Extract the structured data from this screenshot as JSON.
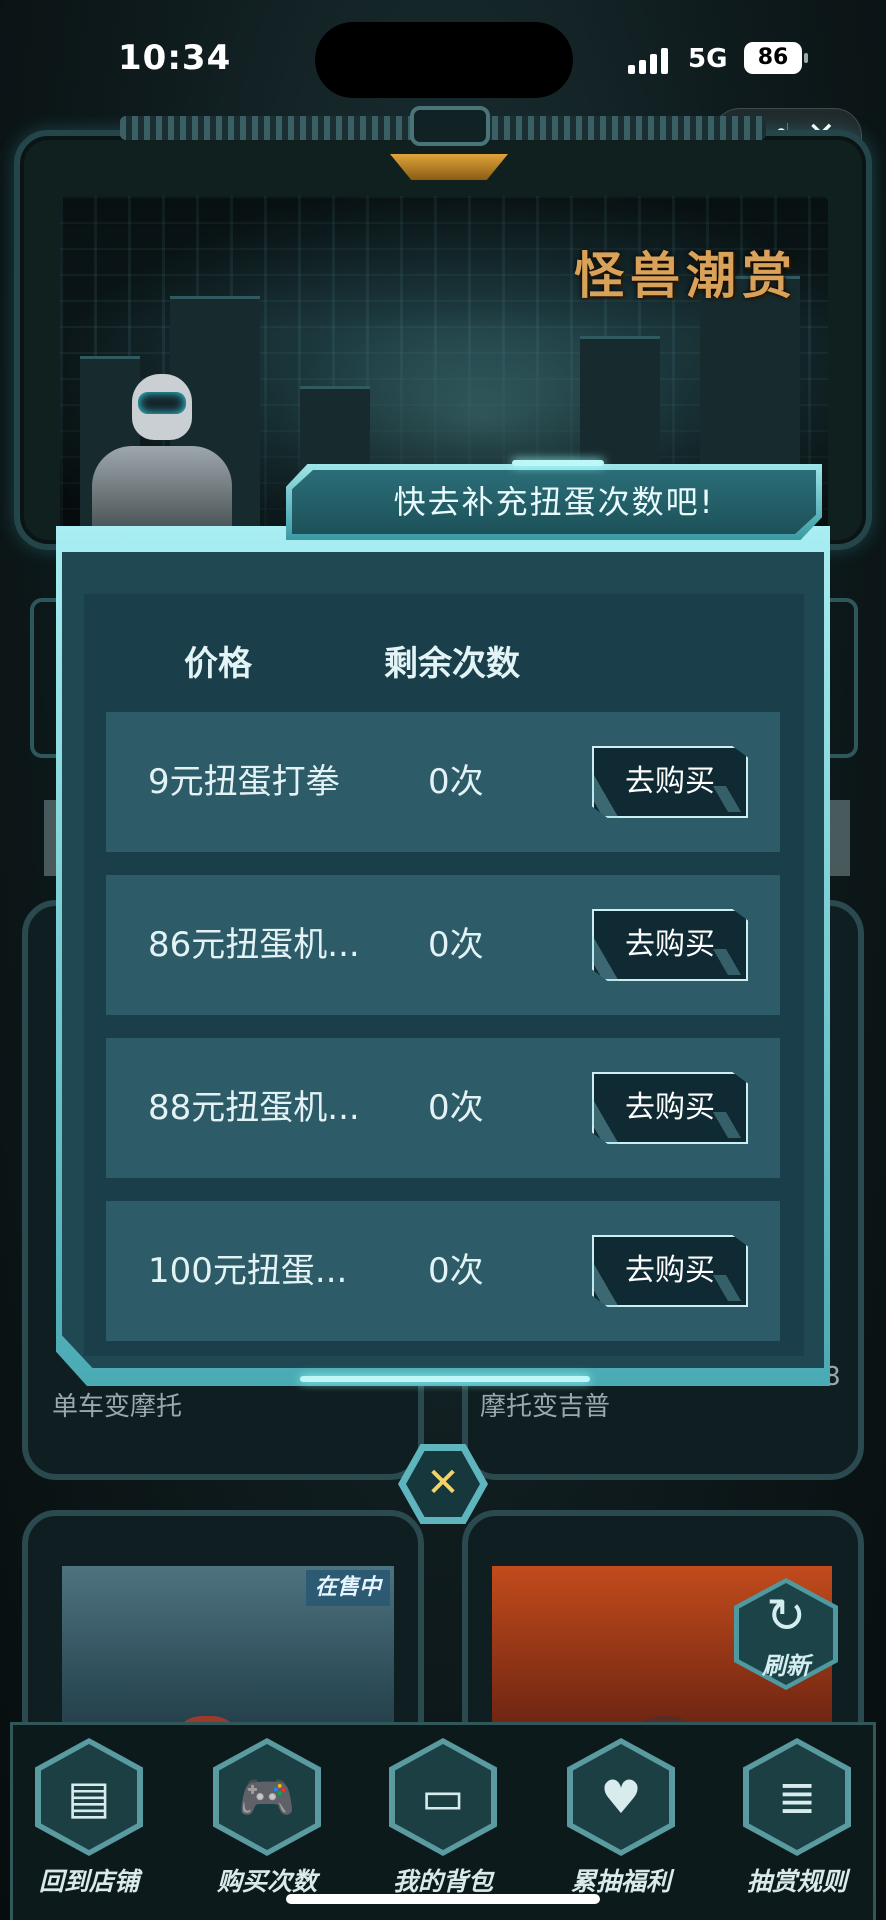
{
  "status_bar": {
    "time": "10:34",
    "network": "5G",
    "battery": "86"
  },
  "capsule": {
    "more_glyph": "•••",
    "close_glyph": "✕"
  },
  "banner": {
    "title": "怪兽潮赏"
  },
  "popup": {
    "header": "快去补充扭蛋次数吧!",
    "columns": {
      "price": "价格",
      "remaining": "剩余次数"
    },
    "rows": [
      {
        "name": "9元扭蛋打拳",
        "count": "0次",
        "button": "去购买"
      },
      {
        "name": "86元扭蛋机...",
        "count": "0次",
        "button": "去购买"
      },
      {
        "name": "88元扭蛋机...",
        "count": "0次",
        "button": "去购买"
      },
      {
        "name": "100元扭蛋...",
        "count": "0次",
        "button": "去购买"
      }
    ]
  },
  "background": {
    "left_card_label": "单车变摩托",
    "right_card_label": "摩托变吉普",
    "right_card_corner_digit": "8",
    "on_sale_badge": "在售中",
    "refresh_label": "刷新"
  },
  "bottom_nav": [
    {
      "label": "回到店铺",
      "icon": "store-icon",
      "glyph": "▤"
    },
    {
      "label": "购买次数",
      "icon": "gamepad-icon",
      "glyph": "🎮"
    },
    {
      "label": "我的背包",
      "icon": "box-icon",
      "glyph": "▭"
    },
    {
      "label": "累抽福利",
      "icon": "heart-icon",
      "glyph": "♥"
    },
    {
      "label": "抽赏规则",
      "icon": "document-icon",
      "glyph": "≣"
    }
  ],
  "colors": {
    "accent": "#5fb5bd",
    "popup_bg": "#1f4853",
    "row_bg": "#2d5b67",
    "button_bg": "#102a33",
    "title_gold": "#d9a25a"
  }
}
